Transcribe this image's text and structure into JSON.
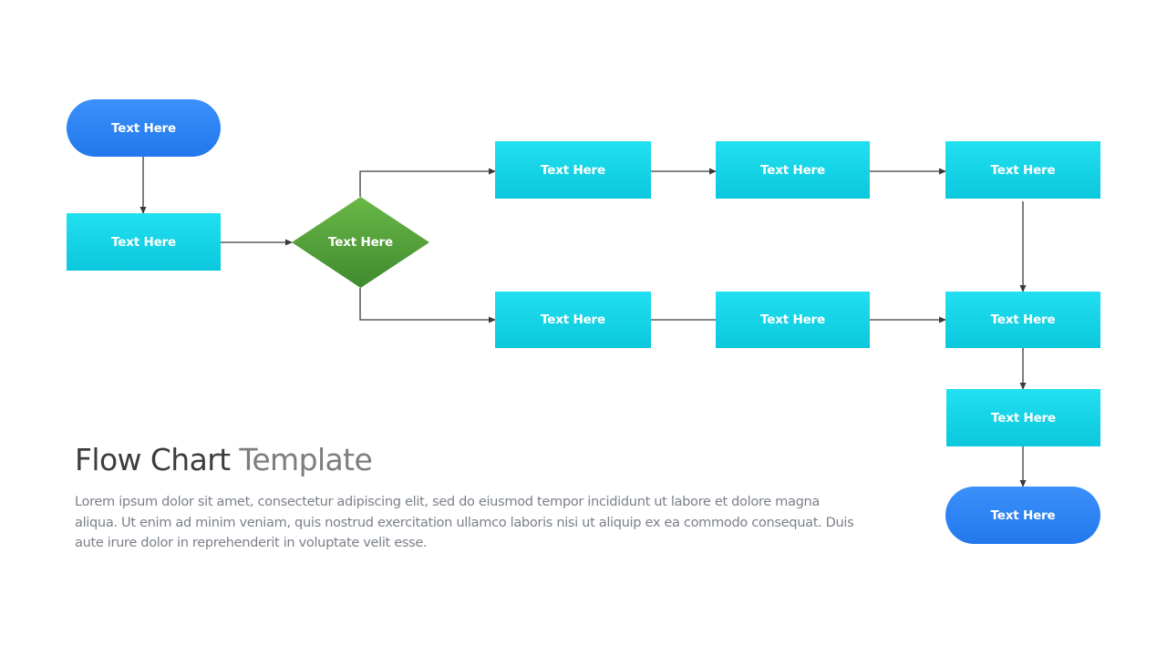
{
  "colors": {
    "process_top": "#21e0f0",
    "process_bottom": "#0bc8dd",
    "terminal_top": "#3b90fb",
    "terminal_bottom": "#2278ec",
    "decision_top": "#6ab846",
    "decision_bottom": "#3f8a2f",
    "connector": "#3a3a3a",
    "title_primary": "#3d3d3d",
    "title_secondary": "#7d7d7d",
    "body_text": "#7b8089"
  },
  "flowchart": {
    "start": {
      "label": "Text Here",
      "shape": "terminal"
    },
    "step_1": {
      "label": "Text Here",
      "shape": "process"
    },
    "decision": {
      "label": "Text Here",
      "shape": "decision"
    },
    "top_branch": [
      {
        "label": "Text Here",
        "shape": "process"
      },
      {
        "label": "Text Here",
        "shape": "process"
      },
      {
        "label": "Text Here",
        "shape": "process"
      }
    ],
    "bottom_branch": [
      {
        "label": "Text Here",
        "shape": "process"
      },
      {
        "label": "Text Here",
        "shape": "process"
      },
      {
        "label": "Text Here",
        "shape": "process"
      }
    ],
    "step_final": {
      "label": "Text Here",
      "shape": "process"
    },
    "end": {
      "label": "Text Here",
      "shape": "terminal"
    },
    "connections": [
      {
        "from": "start",
        "to": "step_1",
        "arrow": true
      },
      {
        "from": "step_1",
        "to": "decision",
        "arrow": true
      },
      {
        "from": "decision",
        "to": "top_branch.0",
        "arrow": true
      },
      {
        "from": "decision",
        "to": "bottom_branch.0",
        "arrow": true
      },
      {
        "from": "top_branch.0",
        "to": "top_branch.1",
        "arrow": true
      },
      {
        "from": "top_branch.1",
        "to": "top_branch.2",
        "arrow": true
      },
      {
        "from": "top_branch.2",
        "to": "bottom_branch.2",
        "arrow": true
      },
      {
        "from": "bottom_branch.0",
        "to": "bottom_branch.1",
        "arrow": false
      },
      {
        "from": "bottom_branch.1",
        "to": "bottom_branch.2",
        "arrow": true
      },
      {
        "from": "bottom_branch.2",
        "to": "step_final",
        "arrow": true
      },
      {
        "from": "step_final",
        "to": "end",
        "arrow": true
      }
    ]
  },
  "title": {
    "primary": "Flow Chart",
    "secondary": "Template"
  },
  "description": "Lorem ipsum dolor sit amet, consectetur adipiscing elit, sed do eiusmod tempor incididunt ut labore et dolore magna aliqua. Ut enim ad minim veniam, quis nostrud exercitation ullamco laboris nisi ut aliquip ex ea commodo consequat. Duis aute irure dolor in reprehenderit in voluptate velit esse."
}
